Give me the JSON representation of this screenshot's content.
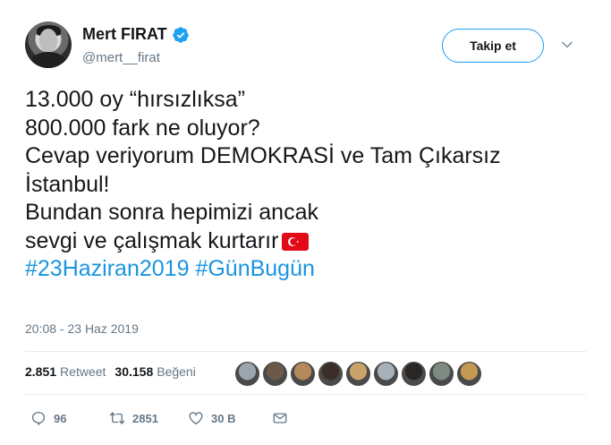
{
  "user": {
    "display_name": "Mert FIRAT",
    "handle": "@mert__firat",
    "verified": true
  },
  "follow_button": {
    "label": "Takip et"
  },
  "tweet": {
    "lines": [
      "13.000 oy “hırsızlıksa”",
      "800.000 fark ne oluyor?",
      "Cevap veriyorum DEMOKRASİ ve Tam Çıkarsız",
      "İstanbul!",
      "Bundan sonra hepimizi ancak",
      "sevgi ve çalışmak kurtarır"
    ],
    "emoji": "turkey-flag",
    "hashtags": [
      "#23Haziran2019",
      "#GünBugün"
    ]
  },
  "timestamp": "20:08 - 23 Haz 2019",
  "stats": {
    "retweet_count": "2.851",
    "retweet_label": "Retweet",
    "like_count": "30.158",
    "like_label": "Beğeni"
  },
  "likers": [
    {
      "color": "#9aa5ae"
    },
    {
      "color": "#6b5a48"
    },
    {
      "color": "#b58a5a"
    },
    {
      "color": "#3a2e2a"
    },
    {
      "color": "#c9a36a"
    },
    {
      "color": "#a7b0b8"
    },
    {
      "color": "#2a2624"
    },
    {
      "color": "#7d8a80"
    },
    {
      "color": "#c49a52"
    }
  ],
  "actions": {
    "reply_count": "96",
    "retweet_count": "2851",
    "like_count": "30 B"
  },
  "colors": {
    "accent": "#1da1f2",
    "hashtag": "#1b95e0",
    "secondary_text": "#657786",
    "flag_red": "#e30a17"
  }
}
